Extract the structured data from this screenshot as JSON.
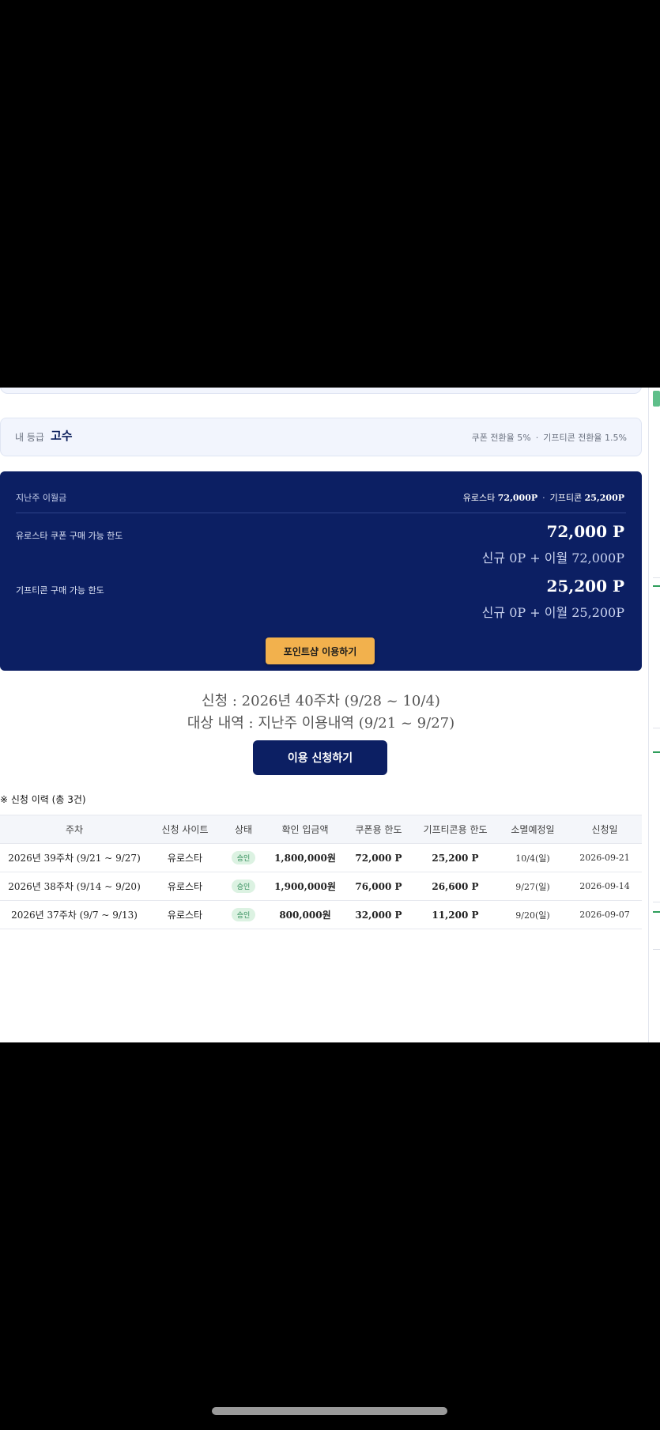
{
  "grade": {
    "label": "내 등급",
    "value": "고수",
    "coupon_rate": "쿠폰 전환율 5%",
    "separator": "·",
    "gifticon_rate": "기프티콘 전환율 1.5%"
  },
  "carryover": {
    "label": "지난주 이월금",
    "eurostar_prefix": "유로스타",
    "eurostar_value": "72,000P",
    "separator": "·",
    "gifticon_prefix": "기프티콘",
    "gifticon_value": "25,200P"
  },
  "limits": [
    {
      "label": "유로스타 쿠폰 구매 가능 한도",
      "amount": "72,000 P",
      "detail": "신규 0P + 이월 72,000P"
    },
    {
      "label": "기프티콘 구매 가능 한도",
      "amount": "25,200 P",
      "detail": "신규 0P + 이월 25,200P"
    }
  ],
  "pointshop_button": "포인트샵 이용하기",
  "apply": {
    "week_text": "신청 : 2026년 40주차 (9/28 ~ 10/4)",
    "target_text": "대상 내역 : 지난주 이용내역 (9/21 ~ 9/27)",
    "button": "이용 신청하기"
  },
  "history": {
    "title": "※ 신청 이력 (총 3건)",
    "columns": [
      "주차",
      "신청 사이트",
      "상태",
      "확인 입금액",
      "쿠폰용 한도",
      "기프티콘용 한도",
      "소멸예정일",
      "신청일"
    ],
    "rows": [
      {
        "week": "2026년 39주차 (9/21 ~ 9/27)",
        "site": "유로스타",
        "status": "승인",
        "deposit": "1,800,000원",
        "coupon": "72,000 P",
        "gifticon": "25,200 P",
        "expire": "10/4(일)",
        "date": "2026-09-21"
      },
      {
        "week": "2026년 38주차 (9/14 ~ 9/20)",
        "site": "유로스타",
        "status": "승인",
        "deposit": "1,900,000원",
        "coupon": "76,000 P",
        "gifticon": "26,600 P",
        "expire": "9/27(일)",
        "date": "2026-09-14"
      },
      {
        "week": "2026년 37주차 (9/7 ~ 9/13)",
        "site": "유로스타",
        "status": "승인",
        "deposit": "800,000원",
        "coupon": "32,000 P",
        "gifticon": "11,200 P",
        "expire": "9/20(일)",
        "date": "2026-09-07"
      }
    ]
  },
  "colors": {
    "navy": "#0c1f63",
    "accent": "#f2b14d",
    "approved_bg": "#dcf2e2",
    "approved_text": "#2e8b57"
  }
}
